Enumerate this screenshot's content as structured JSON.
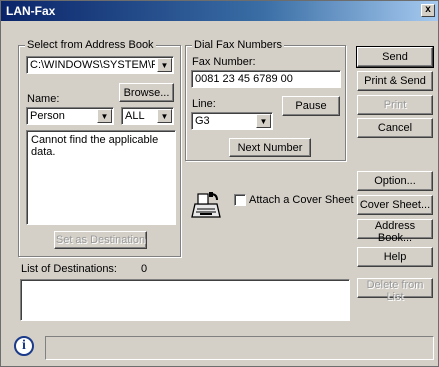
{
  "window": {
    "title": "LAN-Fax",
    "close_glyph": "x"
  },
  "address_book": {
    "legend": "Select from Address Book",
    "path_value": "C:\\WINDOWS\\SYSTEM\\FXD\\",
    "browse_label": "Browse...",
    "name_label": "Name:",
    "name_value": "Person",
    "filter_value": "ALL",
    "list_message": "Cannot find the applicable data.",
    "set_destination_label": "Set as Destination"
  },
  "dial": {
    "legend": "Dial Fax Numbers",
    "fax_number_label": "Fax Number:",
    "fax_number_value": "0081 23 45 6789 00",
    "line_label": "Line:",
    "line_value": "G3",
    "pause_label": "Pause",
    "next_number_label": "Next Number"
  },
  "cover_sheet": {
    "checkbox_label": "Attach a Cover Sheet",
    "icon": "fax-machine-icon"
  },
  "actions": {
    "send": "Send",
    "print_send": "Print & Send",
    "print": "Print",
    "cancel": "Cancel",
    "option": "Option...",
    "cover_sheet": "Cover Sheet...",
    "address_book": "Address Book...",
    "help": "Help",
    "delete_from_list": "Delete from List"
  },
  "destinations": {
    "label": "List of Destinations:",
    "count": "0"
  },
  "status": {
    "icon": "info-icon",
    "glyph": "i"
  }
}
